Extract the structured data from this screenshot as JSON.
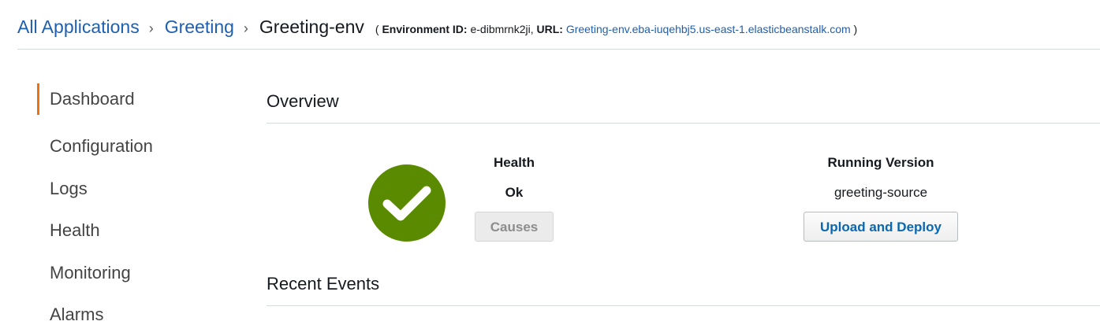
{
  "breadcrumb": {
    "all_apps": "All Applications",
    "app": "Greeting",
    "separator": "›",
    "current": "Greeting-env",
    "open_paren": "(",
    "env_id_label": "Environment ID:",
    "env_id": "e-dibmrnk2ji,",
    "url_label": "URL:",
    "url": "Greeting-env.eba-iuqehbj5.us-east-1.elasticbeanstalk.com",
    "close_paren": ")"
  },
  "sidebar": {
    "items": [
      {
        "label": "Dashboard",
        "active": true
      },
      {
        "label": "Configuration"
      },
      {
        "label": "Logs"
      },
      {
        "label": "Health"
      },
      {
        "label": "Monitoring"
      },
      {
        "label": "Alarms"
      }
    ]
  },
  "overview": {
    "title": "Overview",
    "health": {
      "label": "Health",
      "status": "Ok",
      "icon": "check-circle-icon",
      "icon_color": "#5a8a00",
      "causes_button": "Causes"
    },
    "version": {
      "label": "Running Version",
      "value": "greeting-source",
      "deploy_button": "Upload and Deploy"
    }
  },
  "events": {
    "title": "Recent Events"
  },
  "colors": {
    "link": "#1f5fb0",
    "accent": "#ec7211",
    "primary_button_text": "#0a67b0"
  }
}
